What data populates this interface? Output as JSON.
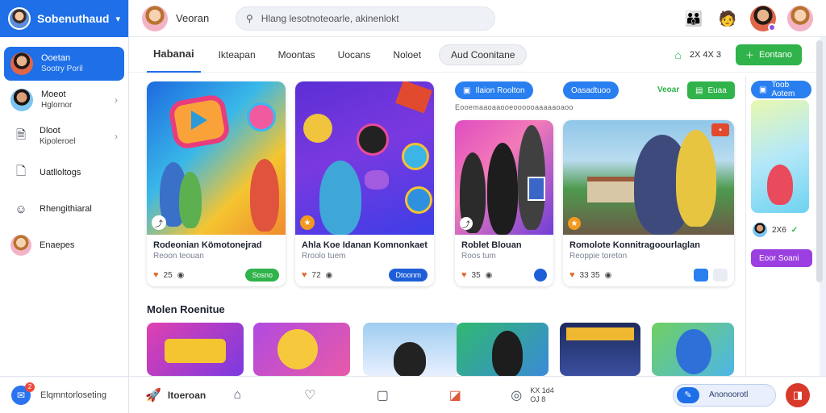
{
  "sidebar": {
    "header_title": "Sobenuthaud",
    "items": [
      {
        "label": "Ooetan",
        "sub": "Sootry Poril",
        "icon": "avatar",
        "active": true
      },
      {
        "label": "Moeot",
        "sub": "Hglornor",
        "icon": "avatar",
        "active": false
      },
      {
        "label": "Dloot",
        "sub": "Kipoleroel",
        "icon": "document-icon",
        "active": false
      },
      {
        "label": "Uatlloltogs",
        "sub": "",
        "icon": "file-icon",
        "active": false
      },
      {
        "label": "Rhengithiaral",
        "sub": "",
        "icon": "help-icon",
        "active": false
      },
      {
        "label": "Enaepes",
        "sub": "",
        "icon": "avatar",
        "active": false
      }
    ],
    "footer_label": "Elqmntorloseting",
    "footer_badge": "2"
  },
  "topbar": {
    "user_name": "Veoran",
    "search_value": "Hlang lesotnoteoarle, akinenlokt"
  },
  "tabs": {
    "items": [
      "Habanai",
      "Ikteapan",
      "Moontas",
      "Uocans",
      "Noloet",
      "Aud Coonitane"
    ],
    "right_count": "2X 4X 3",
    "right_button": "Eontano"
  },
  "cards": [
    {
      "title": "Rodeonian Kömotonejrad",
      "sub": "Reoon teouan",
      "count": "25",
      "chip": "Sosno"
    },
    {
      "title": "Ahla Koe Idanan Komnonkaet",
      "sub": "Rroolo tuem",
      "count": "72",
      "chip": "Dtoonm"
    },
    {
      "title": "Roblet Blouan",
      "sub": "Roos tum",
      "count": "35",
      "chip": ""
    },
    {
      "title": "Romolote Konnitragoourlaglan",
      "sub": "Reoppie toreton",
      "count": "33 35",
      "chip": ""
    }
  ],
  "filters": {
    "pill1": "Ilaion Roolton",
    "pill2": "Oasadtuoo",
    "label": "Veoar",
    "green": "Euaa",
    "caption": "Eooemaaoaaooeoooooaaaaaoaoo"
  },
  "right_panel": {
    "pill": "Toob Aotem",
    "count": "2X6",
    "button": "Eoor Soani"
  },
  "row": {
    "title": "Molen Roenitue"
  },
  "bottombar": {
    "active_label": "Itoeroan",
    "stat": "KX 1d4\nOJ 8",
    "button_label": "Anonoorotl"
  },
  "colors": {
    "brand_blue": "#1e6fe8",
    "green": "#2fb34a",
    "purple": "#9b3fe0",
    "red": "#d8392b"
  }
}
